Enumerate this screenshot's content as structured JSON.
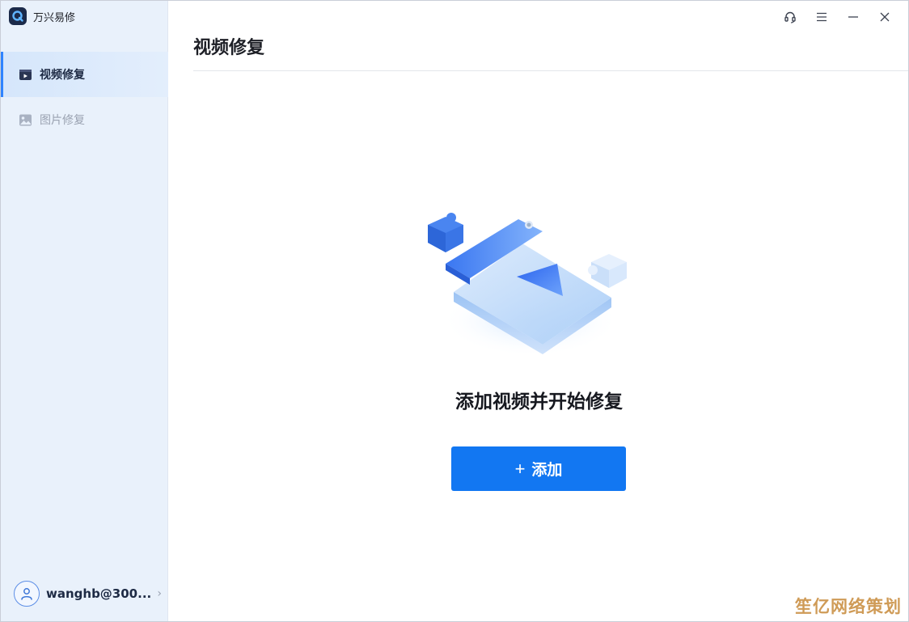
{
  "app": {
    "name": "万兴易修"
  },
  "sidebar": {
    "items": [
      {
        "label": "视频修复",
        "icon": "video-repair-icon",
        "active": true
      },
      {
        "label": "图片修复",
        "icon": "image-repair-icon",
        "active": false
      }
    ],
    "user": {
      "name": "wanghb@300..."
    }
  },
  "window_controls": [
    "headset-icon",
    "menu-icon",
    "minimize-icon",
    "close-icon"
  ],
  "main": {
    "title": "视频修复",
    "empty_state": {
      "message": "添加视频并开始修复",
      "add_button_label": "添加",
      "add_button_icon": "+"
    }
  },
  "watermark": "笙亿网络策划",
  "colors": {
    "accent": "#1277f2",
    "sidebar_bg": "#e9f1fb",
    "active_indicator": "#2f83ff"
  }
}
